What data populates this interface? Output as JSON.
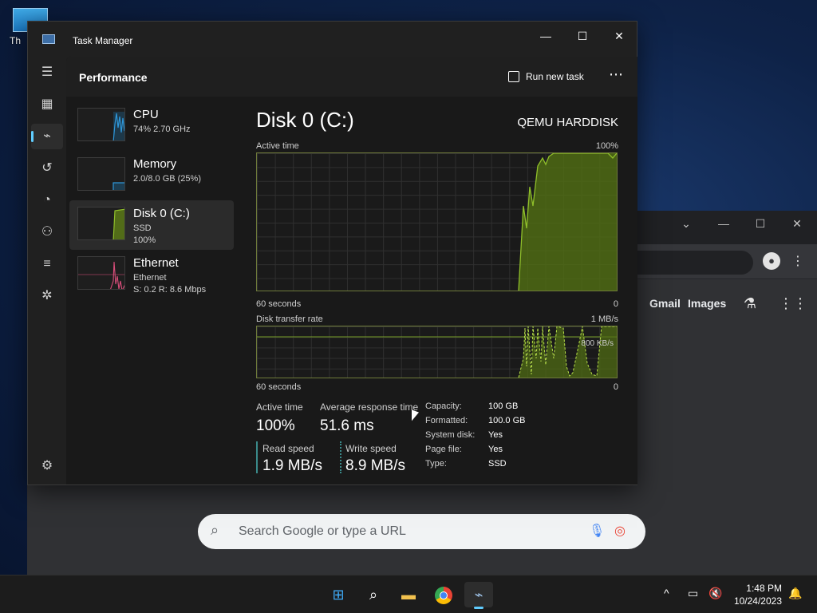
{
  "desktop": {
    "icon_label": "Th"
  },
  "chrome": {
    "links": [
      "Gmail",
      "Images"
    ],
    "search_placeholder": "Search Google or type a URL"
  },
  "taskmanager": {
    "title": "Task Manager",
    "page_title": "Performance",
    "run_new_task": "Run new task",
    "nav_icons": [
      "hamburger-icon",
      "processes-icon",
      "performance-icon",
      "app-history-icon",
      "startup-apps-icon",
      "users-icon",
      "details-icon",
      "services-icon",
      "settings-icon"
    ],
    "resources": [
      {
        "name": "CPU",
        "line1": "74%  2.70 GHz",
        "line2": "",
        "color": "#2e96d8",
        "level": 0.74
      },
      {
        "name": "Memory",
        "line1": "2.0/8.0 GB (25%)",
        "line2": "",
        "color": "#2e96d8",
        "level": 0.25
      },
      {
        "name": "Disk 0 (C:)",
        "line1": "SSD",
        "line2": "100%",
        "color": "#8fbf2a",
        "level": 1.0
      },
      {
        "name": "Ethernet",
        "line1": "Ethernet",
        "line2": "S: 0.2  R: 8.6 Mbps",
        "color": "#d84d7a",
        "level": 0.4
      }
    ],
    "selected_resource": 2,
    "detail": {
      "title": "Disk 0 (C:)",
      "model": "QEMU HARDDISK",
      "active_time_label": "Active time",
      "active_time_max": "100%",
      "axis_left": "60 seconds",
      "axis_right": "0",
      "transfer_label": "Disk transfer rate",
      "transfer_max": "1 MB/s",
      "transfer_marker": "800 KB/s",
      "stats": {
        "active_time": {
          "label": "Active time",
          "value": "100%"
        },
        "avg_response": {
          "label": "Average response time",
          "value": "51.6 ms"
        },
        "read_speed": {
          "label": "Read speed",
          "value": "1.9 MB/s"
        },
        "write_speed": {
          "label": "Write speed",
          "value": "8.9 MB/s"
        }
      },
      "properties": [
        {
          "key": "Capacity:",
          "value": "100 GB"
        },
        {
          "key": "Formatted:",
          "value": "100.0 GB"
        },
        {
          "key": "System disk:",
          "value": "Yes"
        },
        {
          "key": "Page file:",
          "value": "Yes"
        },
        {
          "key": "Type:",
          "value": "SSD"
        }
      ]
    }
  },
  "taskbar": {
    "time": "1:48 PM",
    "date": "10/24/2023",
    "apps": [
      "start-icon",
      "search-icon",
      "file-explorer-icon",
      "chrome-icon",
      "task-manager-icon"
    ]
  },
  "colors": {
    "accent": "#60cdff",
    "disk_green": "#8fbf2a",
    "cpu_blue": "#2e96d8",
    "net_pink": "#d84d7a"
  }
}
